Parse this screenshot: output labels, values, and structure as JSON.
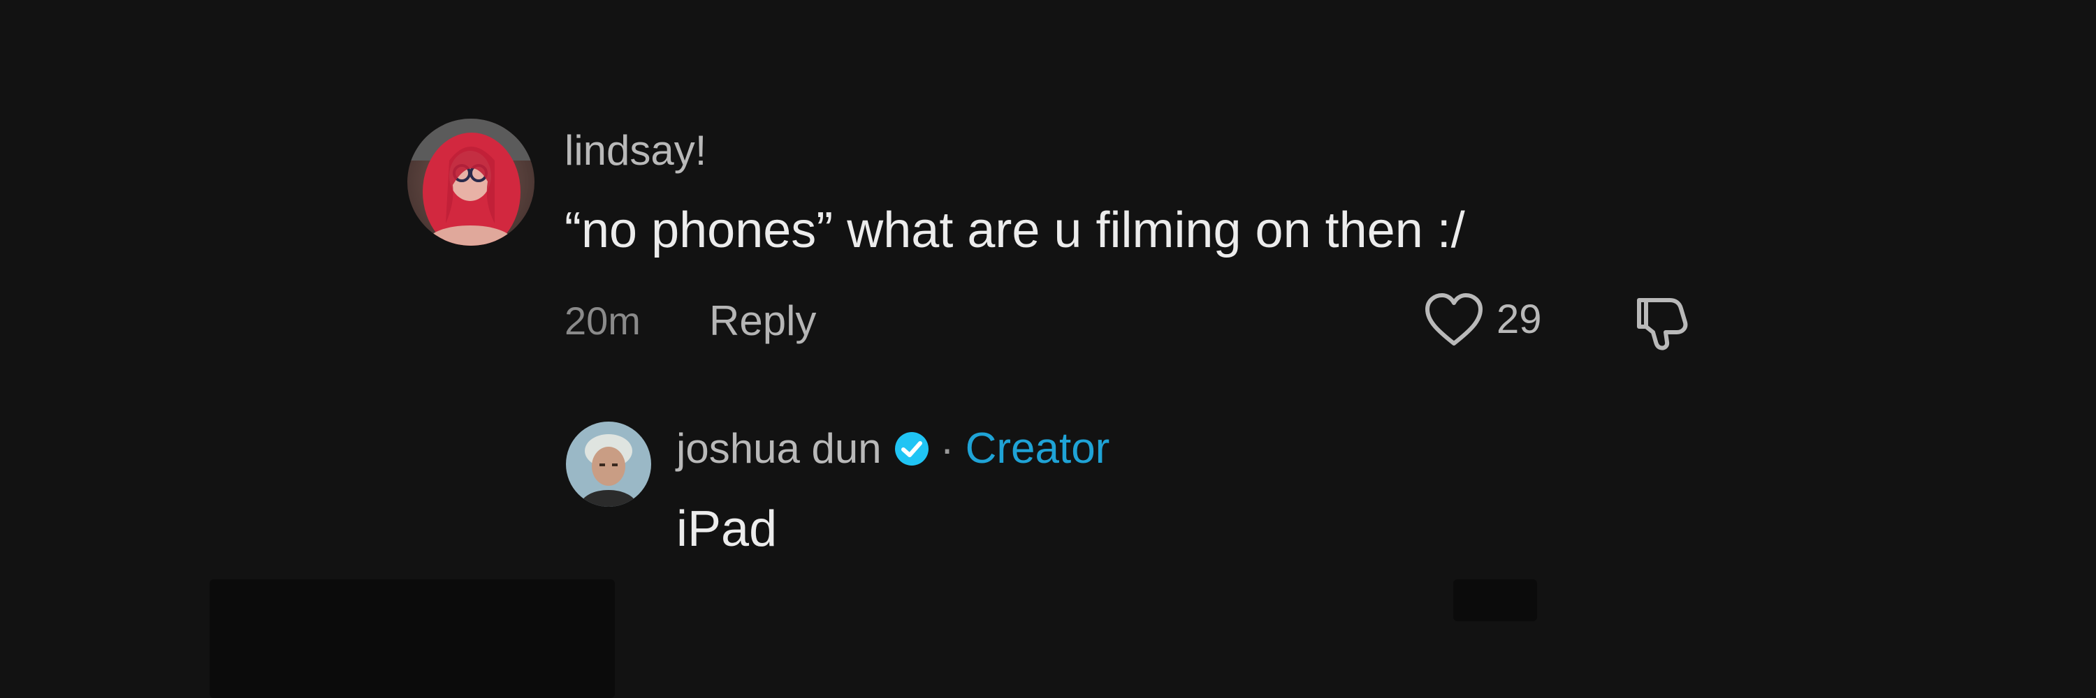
{
  "comment": {
    "username": "lindsay!",
    "text": "“no phones” what are u filming on then :/",
    "timestamp": "20m",
    "reply_label": "Reply",
    "like_count": "29",
    "like_icon": "heart-outline-icon",
    "dislike_icon": "thumbs-down-icon"
  },
  "reply": {
    "username": "joshua dun",
    "verified_icon": "verified-check-icon",
    "separator": "·",
    "badge": "Creator",
    "text": "iPad"
  },
  "colors": {
    "background": "#121212",
    "username": "#b9b9b9",
    "comment_text": "#ececec",
    "meta": "#8a8a8a",
    "creator_accent": "#1fa3d6",
    "verified": "#20c4f4"
  }
}
